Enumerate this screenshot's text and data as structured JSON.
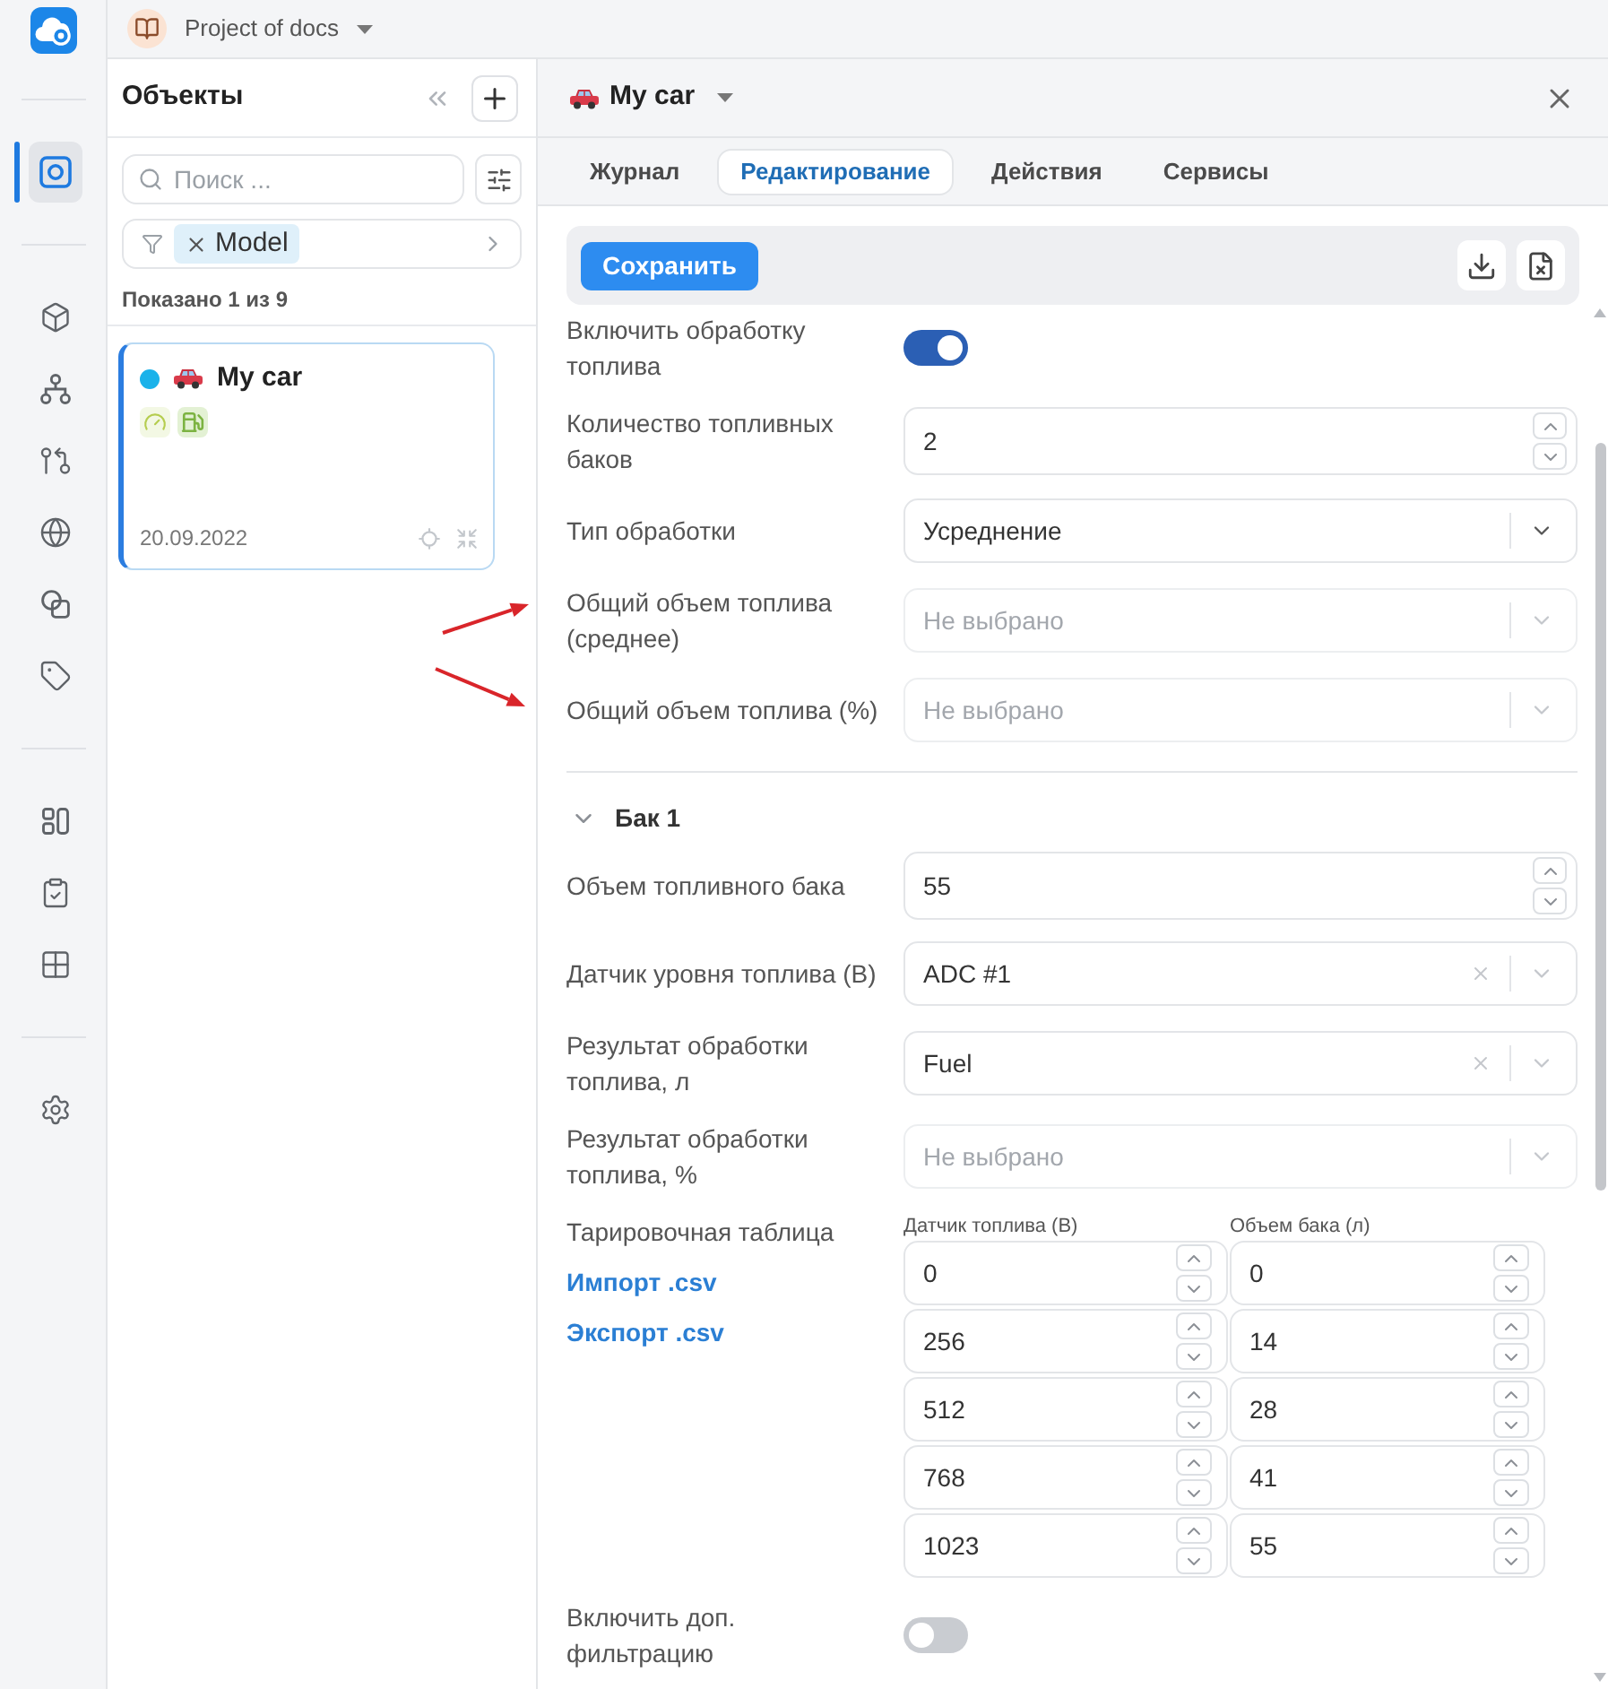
{
  "project": {
    "name": "Project of docs"
  },
  "rail": {
    "sections": [
      {
        "items": [
          {
            "selected": true
          }
        ]
      },
      {
        "items": [
          {
            "selected": false
          },
          {
            "selected": false
          },
          {
            "selected": false
          },
          {
            "selected": false
          },
          {
            "selected": false
          },
          {
            "selected": false
          }
        ]
      },
      {
        "items": [
          {
            "selected": false
          },
          {
            "selected": false
          },
          {
            "selected": false
          }
        ]
      },
      {
        "items": [
          {
            "selected": false
          }
        ]
      }
    ]
  },
  "objects_panel": {
    "title": "Объекты",
    "search": {
      "placeholder": "Поиск ..."
    },
    "filter_chips": [
      "Model"
    ],
    "count": "Показано 1 из 9",
    "items": [
      {
        "name": "My car",
        "date": "20.09.2022",
        "color": "#1ab2ea",
        "selected": true
      }
    ]
  },
  "detail": {
    "title": "My car",
    "tabs": [
      {
        "label": "Журнал",
        "selected": false
      },
      {
        "label": "Редактирование",
        "selected": true
      },
      {
        "label": "Действия",
        "selected": false
      },
      {
        "label": "Сервисы",
        "selected": false
      }
    ],
    "save_button": "Сохранить",
    "fields": [
      {
        "kind": "toggle",
        "label": "Включить обработку топлива",
        "on": true
      },
      {
        "kind": "number",
        "label": "Количество топливных баков",
        "value": "2"
      },
      {
        "kind": "dropdown",
        "label": "Тип обработки",
        "value": "Усреднение"
      },
      {
        "kind": "select",
        "label": "Общий объем топлива (среднее)",
        "placeholder": "Не выбрано"
      },
      {
        "kind": "select",
        "label": "Общий объем топлива (%)",
        "placeholder": "Не выбрано"
      }
    ],
    "sections": [
      {
        "title": "Бак 1",
        "expanded": true,
        "rows": [
          {
            "kind": "number",
            "label": "Объем топливного бака",
            "value": "55"
          },
          {
            "kind": "select",
            "label": "Датчик уровня топлива (В)",
            "value": "ADC #1"
          },
          {
            "kind": "select",
            "label": "Результат обработки топлива, л",
            "value": "Fuel"
          },
          {
            "kind": "select",
            "label": "Результат обработки топлива, %",
            "placeholder": "Не выбрано"
          },
          {
            "kind": "calibration",
            "label": "Тарировочная таблица",
            "links": [
              "Импорт .csv",
              "Экспорт .csv"
            ],
            "columns": [
              "Датчик топлива (В)",
              "Объем бака (л)"
            ],
            "rows": [
              [
                "0",
                "0"
              ],
              [
                "256",
                "14"
              ],
              [
                "512",
                "28"
              ],
              [
                "768",
                "41"
              ],
              [
                "1023",
                "55"
              ]
            ]
          },
          {
            "kind": "toggle",
            "label": "Включить доп. фильтрацию",
            "on": false
          }
        ]
      }
    ]
  }
}
